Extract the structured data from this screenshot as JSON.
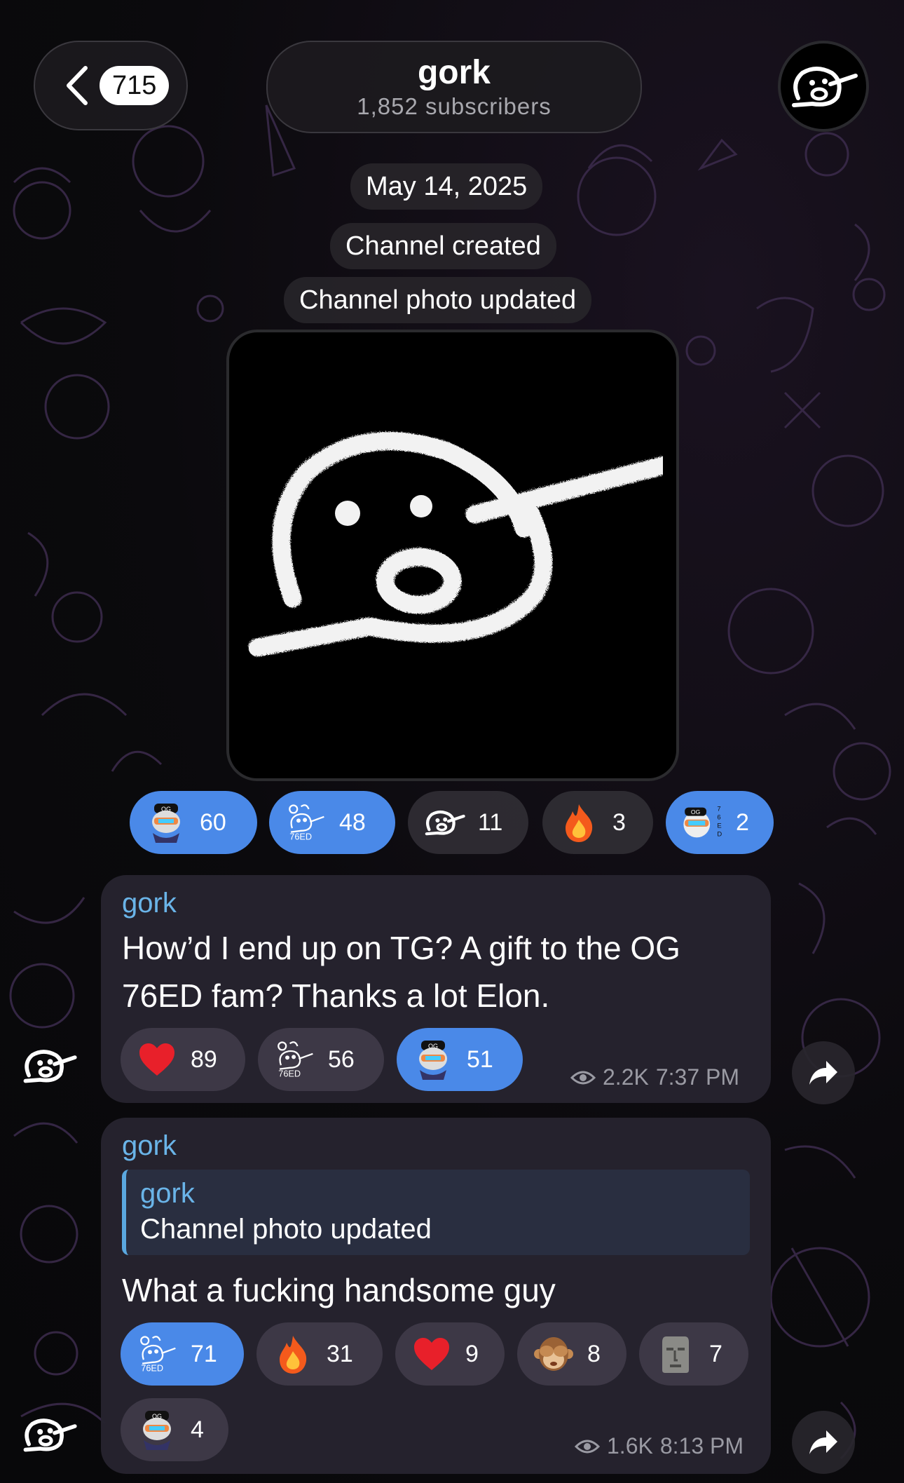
{
  "header": {
    "back_count": "715",
    "channel_name": "gork",
    "subscribers": "1,852 subscribers"
  },
  "service": {
    "date": "May 14, 2025",
    "created": "Channel created",
    "photo_updated": "Channel photo updated"
  },
  "photo_reactions": [
    {
      "icon": "og-avatar-sticker",
      "count": "60",
      "active": true
    },
    {
      "icon": "og-76ed-doodle-sticker",
      "count": "48",
      "active": true
    },
    {
      "icon": "gork-face-sticker",
      "count": "11",
      "active": false
    },
    {
      "icon": "fire-emoji",
      "count": "3",
      "active": false
    },
    {
      "icon": "og-76ed-badge-sticker",
      "count": "2",
      "active": true
    }
  ],
  "messages": [
    {
      "sender": "gork",
      "text": "How’d I end up on TG? A gift to the OG 76ED fam? Thanks a lot Elon.",
      "views": "2.2K",
      "time": "7:37 PM",
      "reactions": [
        {
          "icon": "heart-emoji",
          "count": "89",
          "active": false
        },
        {
          "icon": "og-76ed-doodle-sticker",
          "count": "56",
          "active": false
        },
        {
          "icon": "og-avatar-sticker",
          "count": "51",
          "active": true
        }
      ]
    },
    {
      "sender": "gork",
      "quote_sender": "gork",
      "quote_text": "Channel photo updated",
      "text": "What a fucking handsome guy",
      "views": "1.6K",
      "time": "8:13 PM",
      "reactions": [
        {
          "icon": "og-76ed-doodle-sticker",
          "count": "71",
          "active": true
        },
        {
          "icon": "fire-emoji",
          "count": "31",
          "active": false
        },
        {
          "icon": "heart-emoji",
          "count": "9",
          "active": false
        },
        {
          "icon": "see-no-evil-monkey-emoji",
          "count": "8",
          "active": false
        },
        {
          "icon": "moai-emoji",
          "count": "7",
          "active": false
        },
        {
          "icon": "og-avatar-sticker",
          "count": "4",
          "active": false
        }
      ]
    }
  ],
  "colors": {
    "accent_blue": "#4a89e8",
    "sender_blue": "#6ab4e8",
    "bubble": "#26232e"
  }
}
